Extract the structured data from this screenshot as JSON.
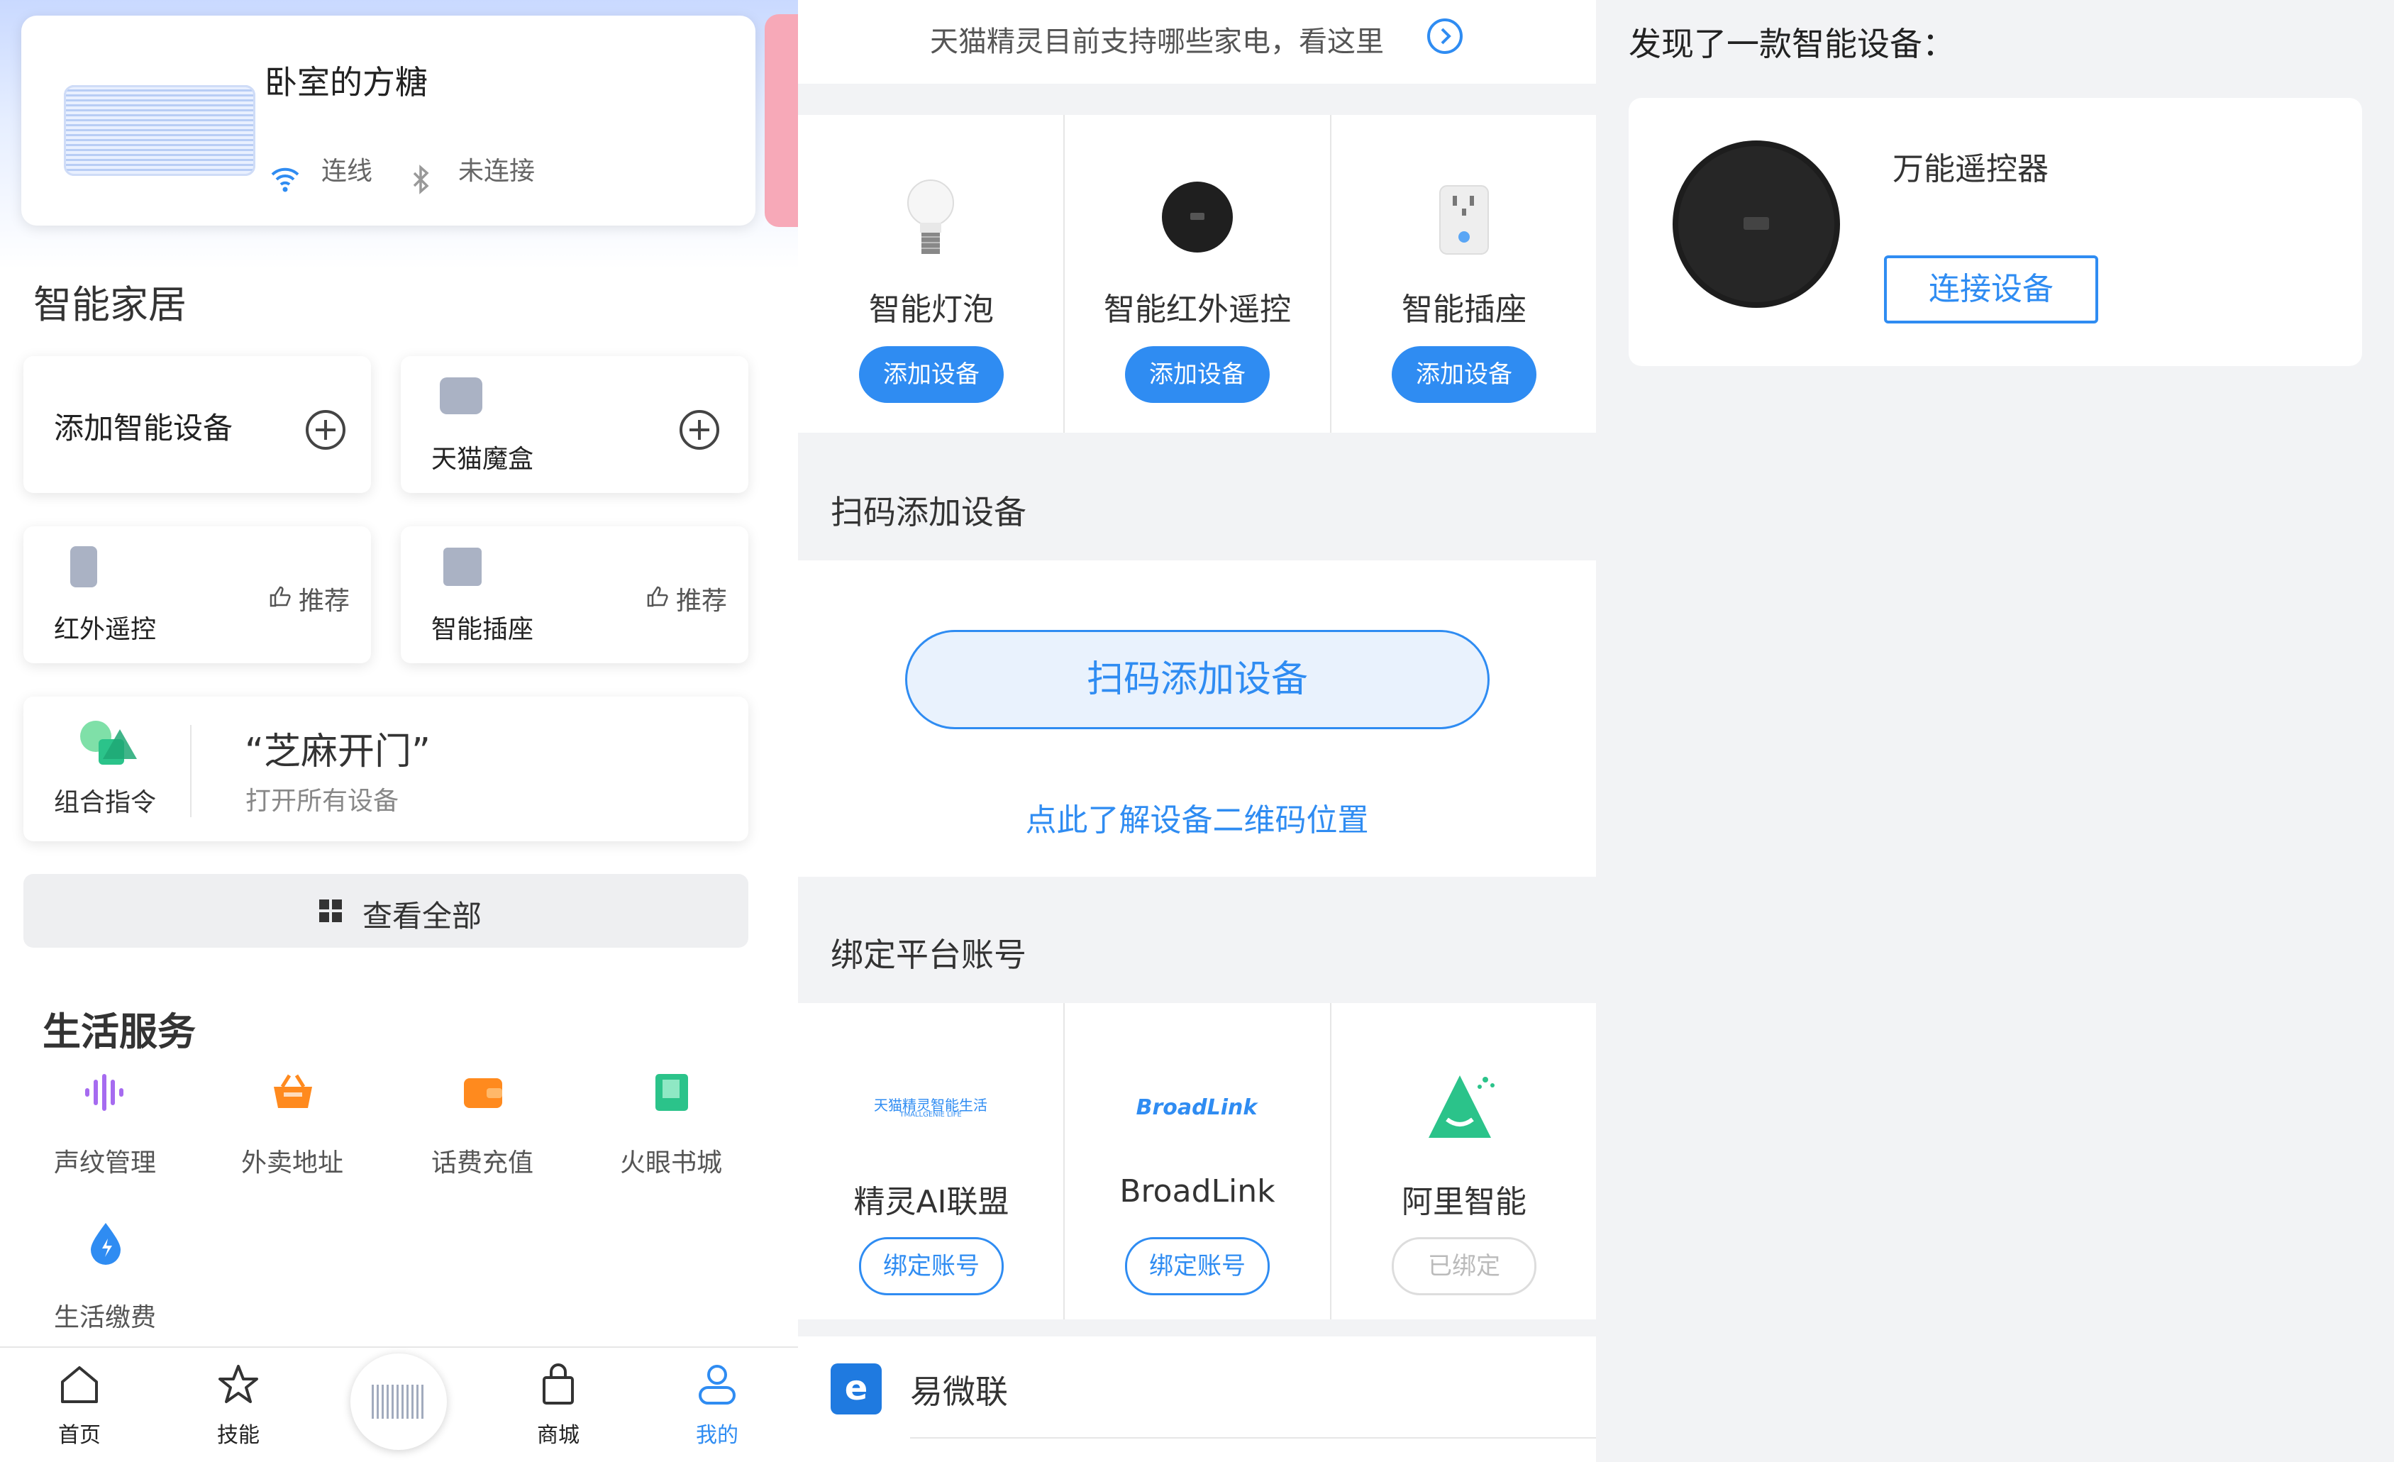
{
  "left": {
    "device": {
      "name": "卧室的方糖",
      "wifi_status": "连线",
      "bt_status": "未连接"
    },
    "smart_home": {
      "title": "智能家居",
      "tiles": [
        {
          "label": "添加智能设备"
        },
        {
          "label": "天猫魔盒"
        },
        {
          "label": "红外遥控",
          "badge": "推荐"
        },
        {
          "label": "智能插座",
          "badge": "推荐"
        }
      ],
      "combo": {
        "label": "组合指令",
        "title": "“芝麻开门”",
        "subtitle": "打开所有设备"
      },
      "view_all": "查看全部"
    },
    "life_services": {
      "title": "生活服务",
      "items": [
        {
          "label": "声纹管理",
          "color": "#a66bf0"
        },
        {
          "label": "外卖地址",
          "color": "#ff8a1e"
        },
        {
          "label": "话费充值",
          "color": "#ff8a1e"
        },
        {
          "label": "火眼书城",
          "color": "#2bc38a"
        },
        {
          "label": "生活缴费",
          "color": "#2f8cf2"
        }
      ]
    },
    "tabbar": {
      "items": [
        {
          "label": "首页"
        },
        {
          "label": "技能"
        },
        {
          "label": "商城"
        },
        {
          "label": "我的",
          "active": true
        }
      ],
      "active_color": "#2f8cf2"
    }
  },
  "mid": {
    "banner": "天猫精灵目前支持哪些家电，看这里",
    "devices": [
      {
        "label": "智能灯泡",
        "button": "添加设备"
      },
      {
        "label": "智能红外遥控",
        "button": "添加设备"
      },
      {
        "label": "智能插座",
        "button": "添加设备"
      }
    ],
    "scan_section": {
      "title": "扫码添加设备",
      "button": "扫码添加设备",
      "link": "点此了解设备二维码位置"
    },
    "bind_section": {
      "title": "绑定平台账号",
      "platforms": [
        {
          "logo_text": "天猫精灵智能生活",
          "logo_sub": "TMALLGENIE LIFE",
          "label": "精灵AI联盟",
          "button": "绑定账号",
          "bound": false
        },
        {
          "logo_text": "BroadLink",
          "label": "BroadLink",
          "button": "绑定账号",
          "bound": false
        },
        {
          "label": "阿里智能",
          "button": "已绑定",
          "bound": true
        }
      ],
      "more_item": {
        "label": "易微联",
        "icon_letter": "e"
      }
    }
  },
  "right": {
    "heading": "发现了一款智能设备：",
    "device": {
      "name": "万能遥控器",
      "button": "连接设备"
    }
  },
  "colors": {
    "accent": "#2f8cf2",
    "bg": "#f2f3f5"
  }
}
